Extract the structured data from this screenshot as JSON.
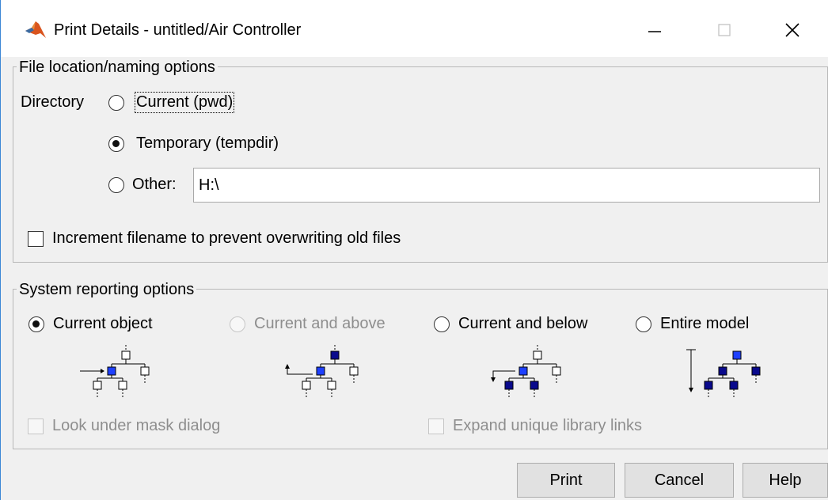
{
  "window": {
    "title": "Print Details - untitled/Air Controller",
    "controls": [
      "minimize",
      "maximize",
      "close"
    ]
  },
  "file_location": {
    "group_label": "File location/naming options",
    "directory_label": "Directory",
    "options": [
      {
        "label": "Current (pwd)",
        "selected": false
      },
      {
        "label": "Temporary (tempdir)",
        "selected": true
      },
      {
        "label": "Other:",
        "selected": false
      }
    ],
    "other_path_value": "H:\\",
    "increment_label": "Increment filename to prevent overwriting old files",
    "increment_checked": false
  },
  "system_reporting": {
    "group_label": "System reporting options",
    "options": [
      {
        "label": "Current object",
        "selected": true,
        "enabled": true,
        "icon": "tree-current-object-icon"
      },
      {
        "label": "Current and above",
        "selected": false,
        "enabled": false,
        "icon": "tree-current-and-above-icon"
      },
      {
        "label": "Current and below",
        "selected": false,
        "enabled": true,
        "icon": "tree-current-and-below-icon"
      },
      {
        "label": "Entire model",
        "selected": false,
        "enabled": true,
        "icon": "tree-entire-model-icon"
      }
    ],
    "look_under_mask_label": "Look under mask dialog",
    "expand_library_links_label": "Expand unique library links"
  },
  "buttons": {
    "print": "Print",
    "cancel": "Cancel",
    "help": "Help"
  },
  "colors": {
    "accent_blue": "#0000ff",
    "dark_blue": "#00008b",
    "window_bg": "#f0f0f0"
  }
}
